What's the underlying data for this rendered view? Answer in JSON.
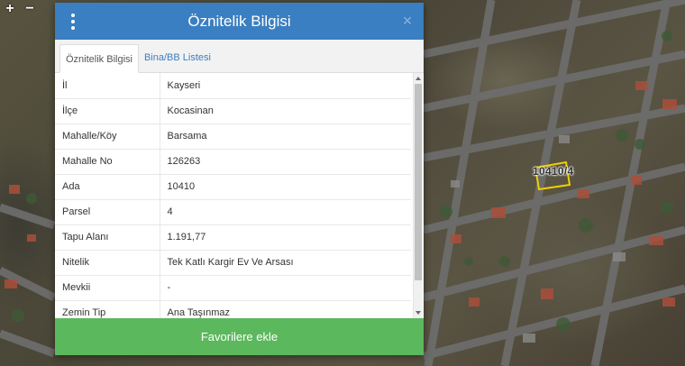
{
  "map": {
    "zoom_in_label": "+",
    "zoom_out_label": "−",
    "parcel_label": "10410/4",
    "highlight_color": "#f0d000"
  },
  "dialog": {
    "title": "Öznitelik Bilgisi",
    "close_label": "×",
    "header_color": "#3a7fc1",
    "tabs": [
      {
        "label": "Öznitelik Bilgisi",
        "active": true
      },
      {
        "label": "Bina/BB Listesi",
        "active": false
      }
    ],
    "rows": [
      {
        "key": "İl",
        "value": "Kayseri"
      },
      {
        "key": "İlçe",
        "value": "Kocasinan"
      },
      {
        "key": "Mahalle/Köy",
        "value": "Barsama"
      },
      {
        "key": "Mahalle No",
        "value": "126263"
      },
      {
        "key": "Ada",
        "value": "10410"
      },
      {
        "key": "Parsel",
        "value": "4"
      },
      {
        "key": "Tapu Alanı",
        "value": "1.191,77"
      },
      {
        "key": "Nitelik",
        "value": "Tek Katlı Kargir Ev Ve Arsası"
      },
      {
        "key": "Mevkii",
        "value": "-"
      },
      {
        "key": "Zemin Tip",
        "value": "Ana Taşınmaz"
      }
    ],
    "favorite_button_label": "Favorilere ekle",
    "favorite_button_color": "#5cb85c"
  }
}
